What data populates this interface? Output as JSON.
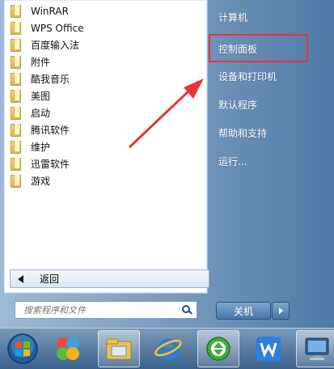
{
  "programs": [
    {
      "label": "WinRAR"
    },
    {
      "label": "WPS Office"
    },
    {
      "label": "百度输入法"
    },
    {
      "label": "附件"
    },
    {
      "label": "酷我音乐"
    },
    {
      "label": "美图"
    },
    {
      "label": "启动"
    },
    {
      "label": "腾讯软件"
    },
    {
      "label": "维护"
    },
    {
      "label": "迅雷软件"
    },
    {
      "label": "游戏"
    }
  ],
  "back": {
    "label": "返回"
  },
  "search": {
    "placeholder": "搜索程序和文件"
  },
  "right_menu": {
    "computer": "计算机",
    "control_panel": "控制面板",
    "devices_printers": "设备和打印机",
    "default_programs": "默认程序",
    "help_support": "帮助和支持",
    "run": "运行..."
  },
  "shutdown": {
    "label": "关机"
  },
  "colors": {
    "annotation": "#e53535"
  },
  "taskbar": {
    "icons": [
      "start-orb-icon",
      "pinwheel-app-icon",
      "file-explorer-icon",
      "internet-explorer-icon",
      "green-sync-app-icon",
      "wps-writer-icon",
      "remote-desktop-icon"
    ]
  }
}
